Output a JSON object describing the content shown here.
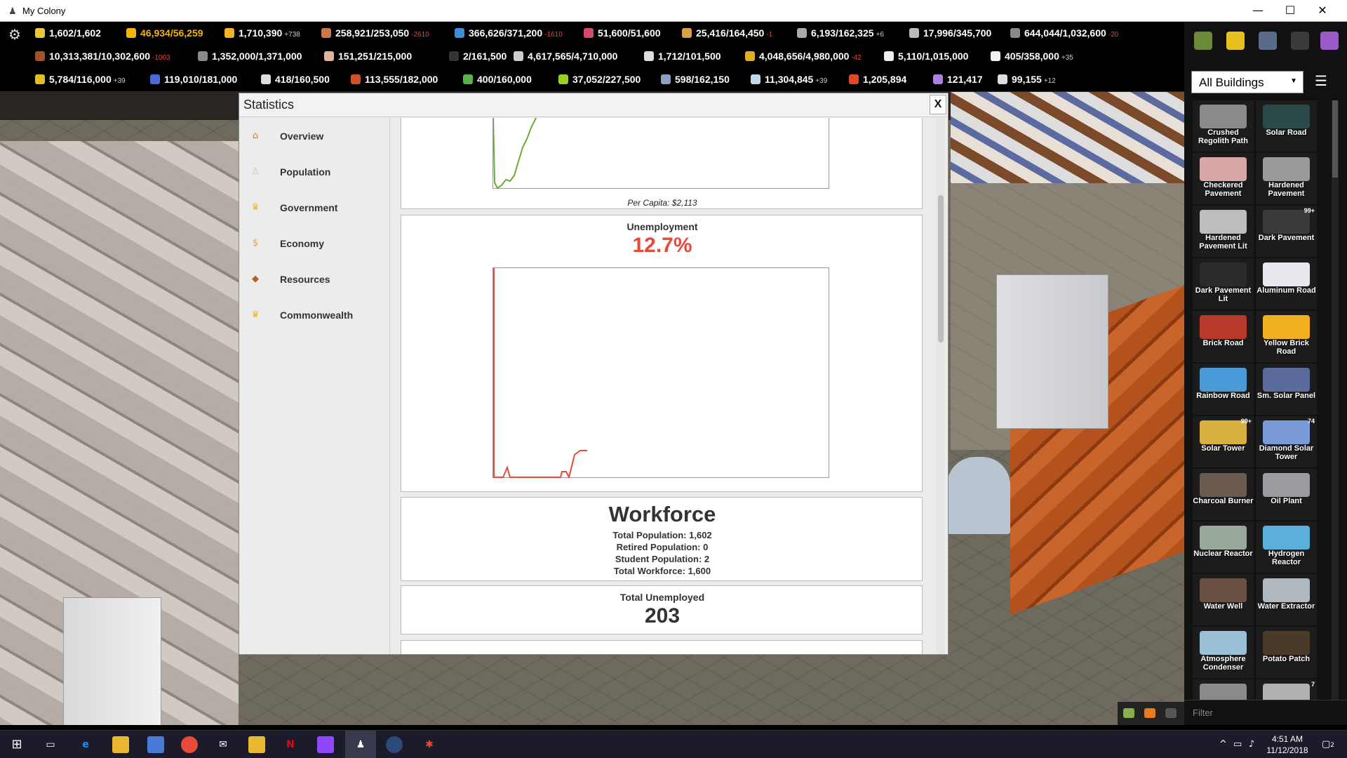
{
  "window": {
    "title": "My Colony",
    "min": "—",
    "max": "☐",
    "close": "✕"
  },
  "resources": {
    "row1": [
      {
        "value": "1,602/1,602",
        "delta": "",
        "color": "#e9c53a",
        "warn": false
      },
      {
        "value": "46,934/56,259",
        "delta": "",
        "color": "#f4b400",
        "warn": true
      },
      {
        "value": "1,710,390",
        "delta": "+738",
        "color": "#f0b429",
        "warn": false
      },
      {
        "value": "258,921/253,050",
        "delta": "-2610",
        "color": "#c97a4a",
        "warn": false
      },
      {
        "value": "366,626/371,200",
        "delta": "-1610",
        "color": "#3a8fd8",
        "warn": false
      },
      {
        "value": "51,600/51,600",
        "delta": "",
        "color": "#d84a6a",
        "warn": false
      },
      {
        "value": "25,416/164,450",
        "delta": "-1",
        "color": "#d9a04a",
        "warn": false
      },
      {
        "value": "6,193/162,325",
        "delta": "+6",
        "color": "#aaaaaa",
        "warn": false
      },
      {
        "value": "17,996/345,700",
        "delta": "",
        "color": "#bbbbbb",
        "warn": false
      },
      {
        "value": "644,044/1,032,600",
        "delta": "-20",
        "color": "#888888",
        "warn": false
      }
    ],
    "row2": [
      {
        "value": "10,313,381/10,302,600",
        "delta": "-1003",
        "color": "#a0522d"
      },
      {
        "value": "1,352,000/1,371,000",
        "delta": "",
        "color": "#8a8a8a"
      },
      {
        "value": "151,251/215,000",
        "delta": "",
        "color": "#e0b49a"
      },
      {
        "value": "2/161,500",
        "delta": "",
        "color": "#333333"
      },
      {
        "value": "4,617,565/4,710,000",
        "delta": "",
        "color": "#cccccc"
      },
      {
        "value": "1,712/101,500",
        "delta": "",
        "color": "#dddddd"
      },
      {
        "value": "4,048,656/4,980,000",
        "delta": "-42",
        "color": "#e0b020"
      },
      {
        "value": "5,110/1,015,000",
        "delta": "",
        "color": "#eeeeee"
      },
      {
        "value": "405/358,000",
        "delta": "+35",
        "color": "#f5f5f5"
      }
    ],
    "row3": [
      {
        "value": "5,784/116,000",
        "delta": "+39",
        "color": "#e0c020"
      },
      {
        "value": "119,010/181,000",
        "delta": "",
        "color": "#4a6ad8"
      },
      {
        "value": "418/160,500",
        "delta": "",
        "color": "#dddddd"
      },
      {
        "value": "113,555/182,000",
        "delta": "",
        "color": "#d0502a"
      },
      {
        "value": "400/160,000",
        "delta": "",
        "color": "#5ab04a"
      },
      {
        "value": "37,052/227,500",
        "delta": "",
        "color": "#9ad020"
      },
      {
        "value": "598/162,150",
        "delta": "",
        "color": "#8aa0c0"
      },
      {
        "value": "11,304,845",
        "delta": "+39",
        "color": "#c0d8e8"
      },
      {
        "value": "1,205,894",
        "delta": "",
        "color": "#e04a2a"
      },
      {
        "value": "121,417",
        "delta": "",
        "color": "#b080e0"
      },
      {
        "value": "99,155",
        "delta": "+12",
        "color": "#dddddd"
      }
    ]
  },
  "stats": {
    "title": "Statistics",
    "close": "X",
    "nav": [
      {
        "label": "Overview",
        "icon": "⌂",
        "icon_name": "overview-icon",
        "color": "#d9722a"
      },
      {
        "label": "Population",
        "icon": "♙",
        "icon_name": "population-icon",
        "color": "#c8c8c8"
      },
      {
        "label": "Government",
        "icon": "♛",
        "icon_name": "crown-icon",
        "color": "#e8b820"
      },
      {
        "label": "Economy",
        "icon": "$",
        "icon_name": "coin-icon",
        "color": "#e8a820"
      },
      {
        "label": "Resources",
        "icon": "◆",
        "icon_name": "resources-icon",
        "color": "#b0602a"
      },
      {
        "label": "Commonwealth",
        "icon": "♛",
        "icon_name": "crown-icon",
        "color": "#e8b820"
      }
    ],
    "gdp": {
      "per_capita": "Per Capita: $2,113"
    },
    "unemployment": {
      "label": "Unemployment",
      "value": "12.7%"
    },
    "workforce": {
      "title": "Workforce",
      "total_population": "Total Population: 1,602",
      "retired": "Retired Population: 0",
      "students": "Student Population: 2",
      "total_workforce": "Total Workforce: 1,600"
    },
    "unemployed": {
      "label": "Total Unemployed",
      "value": "203"
    }
  },
  "build_panel": {
    "filter_select": "All Buildings",
    "filter_placeholder": "Filter",
    "tiles": [
      {
        "label": "Crushed Regolith Path",
        "color": "#8a8a8a",
        "badge": ""
      },
      {
        "label": "Solar Road",
        "color": "#2a4a4a",
        "badge": ""
      },
      {
        "label": "Checkered Pavement",
        "color": "#d8a8a8",
        "badge": ""
      },
      {
        "label": "Hardened Pavement",
        "color": "#9a9a9a",
        "badge": ""
      },
      {
        "label": "Hardened Pavement Lit",
        "color": "#bdbdbd",
        "badge": ""
      },
      {
        "label": "Dark Pavement",
        "color": "#3a3a3a",
        "badge": "99+"
      },
      {
        "label": "Dark Pavement Lit",
        "color": "#2a2a2a",
        "badge": ""
      },
      {
        "label": "Aluminum Road",
        "color": "#e8e8ee",
        "badge": ""
      },
      {
        "label": "Brick Road",
        "color": "#b8382a",
        "badge": ""
      },
      {
        "label": "Yellow Brick Road",
        "color": "#f0b020",
        "badge": ""
      },
      {
        "label": "Rainbow Road",
        "color": "#4a9ad8",
        "badge": ""
      },
      {
        "label": "Sm. Solar Panel",
        "color": "#5a6a9a",
        "badge": ""
      },
      {
        "label": "Solar Tower",
        "color": "#d8b040",
        "badge": "99+"
      },
      {
        "label": "Diamond Solar Tower",
        "color": "#7a9ad8",
        "badge": "74"
      },
      {
        "label": "Charcoal Burner",
        "color": "#6a5a50",
        "badge": ""
      },
      {
        "label": "Oil Plant",
        "color": "#9a9aa0",
        "badge": ""
      },
      {
        "label": "Nuclear Reactor",
        "color": "#9aa89a",
        "badge": ""
      },
      {
        "label": "Hydrogen Reactor",
        "color": "#5ab0d8",
        "badge": ""
      },
      {
        "label": "Water Well",
        "color": "#6a5040",
        "badge": ""
      },
      {
        "label": "Water Extractor",
        "color": "#b0b8c0",
        "badge": ""
      },
      {
        "label": "Atmosphere Condenser",
        "color": "#9ac0d8",
        "badge": ""
      },
      {
        "label": "Potato Patch",
        "color": "#4a3a2a",
        "badge": ""
      },
      {
        "label": "",
        "color": "#8a8a8a",
        "badge": ""
      },
      {
        "label": "",
        "color": "#b0b0b0",
        "badge": "7"
      }
    ]
  },
  "taskbar": {
    "time": "4:51 AM",
    "date": "11/12/2018",
    "notification_count": "2"
  },
  "colors": {
    "unemployment_red": "#e84a3a",
    "gdp_green": "#6aaa3a"
  }
}
